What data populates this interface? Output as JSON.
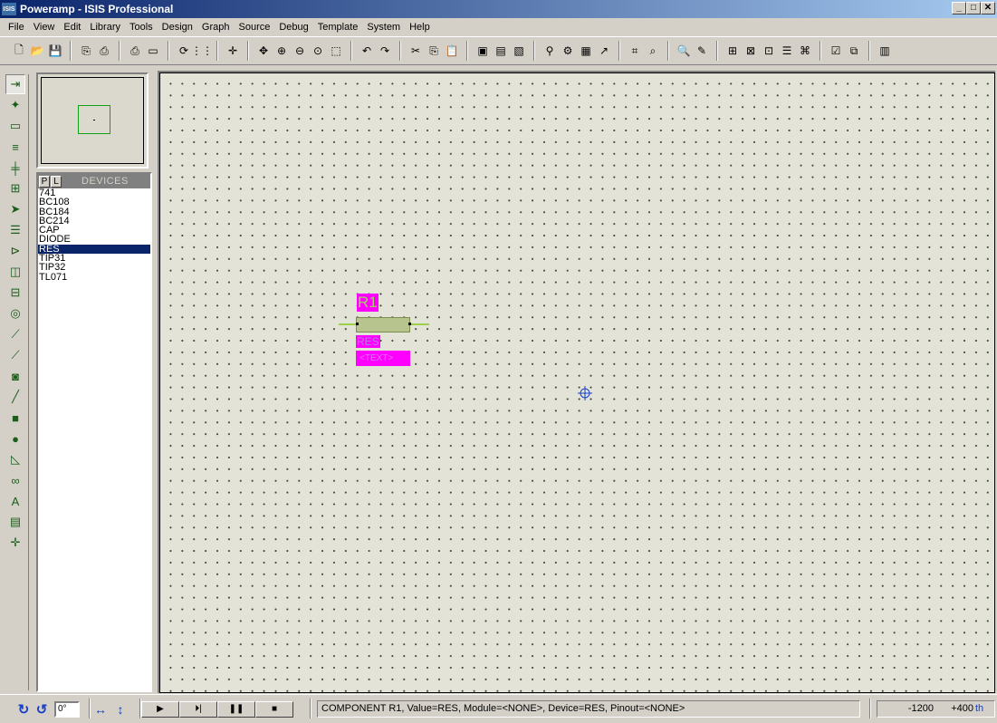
{
  "window": {
    "icon_text": "ISIS",
    "title": "Poweramp - ISIS Professional",
    "minimize": "_",
    "maximize": "□",
    "close": "✕"
  },
  "menu": [
    "File",
    "View",
    "Edit",
    "Library",
    "Tools",
    "Design",
    "Graph",
    "Source",
    "Debug",
    "Template",
    "System",
    "Help"
  ],
  "toolbar_icons": [
    [
      "new-file-icon",
      "open-folder-icon",
      "save-icon"
    ],
    [
      "import-icon",
      "export-icon"
    ],
    [
      "print-icon",
      "print-area-icon"
    ],
    [
      "refresh-icon",
      "grid-icon"
    ],
    [
      "origin-icon"
    ],
    [
      "pan-icon",
      "zoom-in-icon",
      "zoom-out-icon",
      "zoom-all-icon",
      "zoom-area-icon"
    ],
    [
      "undo-icon",
      "redo-icon"
    ],
    [
      "cut-icon",
      "copy-icon",
      "paste-icon"
    ],
    [
      "block-copy-icon",
      "block-move-icon",
      "block-rotate-icon"
    ],
    [
      "pick-device-icon",
      "make-device-icon",
      "package-icon",
      "decompose-icon"
    ],
    [
      "wire-autorouter-icon",
      "search-tag-icon"
    ],
    [
      "find-icon",
      "property-icon"
    ],
    [
      "new-sheet-icon",
      "remove-sheet-icon",
      "goto-sheet-icon",
      "bom-icon",
      "netlist-icon"
    ],
    [
      "electrical-check-icon",
      "ares-icon"
    ],
    [
      "ares-logo-icon"
    ]
  ],
  "toolbar_glyphs": {
    "new-file-icon": "🗋",
    "open-folder-icon": "📂",
    "save-icon": "💾",
    "import-icon": "⎘",
    "export-icon": "⎙",
    "print-icon": "⎙",
    "print-area-icon": "▭",
    "refresh-icon": "⟳",
    "grid-icon": "⋮⋮",
    "origin-icon": "✛",
    "pan-icon": "✥",
    "zoom-in-icon": "⊕",
    "zoom-out-icon": "⊖",
    "zoom-all-icon": "⊙",
    "zoom-area-icon": "⬚",
    "undo-icon": "↶",
    "redo-icon": "↷",
    "cut-icon": "✂",
    "copy-icon": "⎘",
    "paste-icon": "📋",
    "block-copy-icon": "▣",
    "block-move-icon": "▤",
    "block-rotate-icon": "▧",
    "pick-device-icon": "⚲",
    "make-device-icon": "⚙",
    "package-icon": "▦",
    "decompose-icon": "↗",
    "wire-autorouter-icon": "⌗",
    "search-tag-icon": "⌕",
    "find-icon": "🔍",
    "property-icon": "✎",
    "new-sheet-icon": "⊞",
    "remove-sheet-icon": "⊠",
    "goto-sheet-icon": "⊡",
    "bom-icon": "☰",
    "netlist-icon": "⌘",
    "electrical-check-icon": "☑",
    "ares-icon": "⧉",
    "ares-logo-icon": "▥"
  },
  "tools": [
    {
      "name": "component-mode-icon",
      "glyph": "⇥",
      "active": true
    },
    {
      "name": "junction-dot-icon",
      "glyph": "✦",
      "active": false
    },
    {
      "name": "wire-label-icon",
      "glyph": "▭",
      "active": false
    },
    {
      "name": "text-script-icon",
      "glyph": "≡",
      "active": false
    },
    {
      "name": "bus-icon",
      "glyph": "╪",
      "active": false
    },
    {
      "name": "subcircuit-icon",
      "glyph": "⊞",
      "active": false
    },
    {
      "name": "instant-edit-icon",
      "glyph": "➤",
      "active": false
    },
    {
      "name": "terminal-icon",
      "glyph": "☰",
      "active": false
    },
    {
      "name": "device-pin-icon",
      "glyph": "⊳",
      "active": false
    },
    {
      "name": "simulation-graph-icon",
      "glyph": "◫",
      "active": false
    },
    {
      "name": "tape-recorder-icon",
      "glyph": "⊟",
      "active": false
    },
    {
      "name": "generator-icon",
      "glyph": "◎",
      "active": false
    },
    {
      "name": "voltage-probe-icon",
      "glyph": "⟋",
      "active": false
    },
    {
      "name": "current-probe-icon",
      "glyph": "⟋",
      "active": false
    },
    {
      "name": "virtual-instrument-icon",
      "glyph": "◙",
      "active": false
    },
    {
      "name": "line-icon",
      "glyph": "╱",
      "active": false
    },
    {
      "name": "box-icon",
      "glyph": "■",
      "active": false
    },
    {
      "name": "circle-icon",
      "glyph": "●",
      "active": false
    },
    {
      "name": "arc-icon",
      "glyph": "◺",
      "active": false
    },
    {
      "name": "path-icon",
      "glyph": "∞",
      "active": false
    },
    {
      "name": "text-icon",
      "glyph": "A",
      "active": false
    },
    {
      "name": "symbol-icon",
      "glyph": "▤",
      "active": false
    },
    {
      "name": "marker-icon",
      "glyph": "✛",
      "active": false
    }
  ],
  "devices": {
    "tab_p": "P",
    "tab_l": "L",
    "title": "DEVICES",
    "items": [
      "741",
      "BC108",
      "BC184",
      "BC214",
      "CAP",
      "DIODE",
      "RES",
      "TIP31",
      "TIP32",
      "TL071"
    ],
    "selected": "RES"
  },
  "component": {
    "ref": "R1",
    "value": "RES",
    "text": "<TEXT>"
  },
  "bottom": {
    "rotate_cw": "↻",
    "rotate_ccw": "↺",
    "angle": "0°",
    "mirror_h": "↔",
    "mirror_v": "↕",
    "sim": [
      "▶",
      "⏵|",
      "❚❚",
      "■"
    ],
    "status": "COMPONENT R1, Value=RES, Module=<NONE>, Device=RES, Pinout=<NONE>",
    "coord_x": "-1200",
    "coord_y": "+400",
    "coord_unit": "th"
  },
  "colors": {
    "canvas_bg": "#e3e3d8",
    "selected_bg": "#0a246a",
    "label_bg": "#ff00ff",
    "wire": "#9ad046"
  }
}
